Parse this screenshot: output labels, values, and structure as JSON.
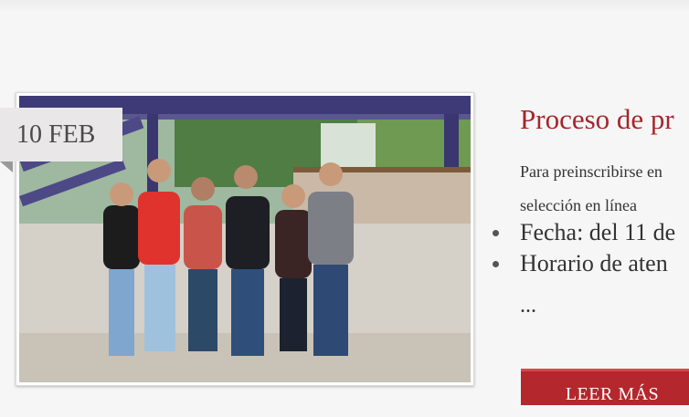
{
  "post": {
    "date_label": "10 FEB",
    "title": "Proceso de pr",
    "summary_line1": "Para preinscribirse en",
    "summary_line2": "selección en línea",
    "bullets": [
      "Fecha: del 11 de",
      "Horario de aten"
    ],
    "ellipsis": "...",
    "read_more_label": "LEER MÁS"
  },
  "colors": {
    "accent": "#a4262c",
    "button": "#b4272d",
    "badge_bg": "#e9e7e7"
  },
  "icons": {
    "photo": "group-of-students-photo"
  }
}
